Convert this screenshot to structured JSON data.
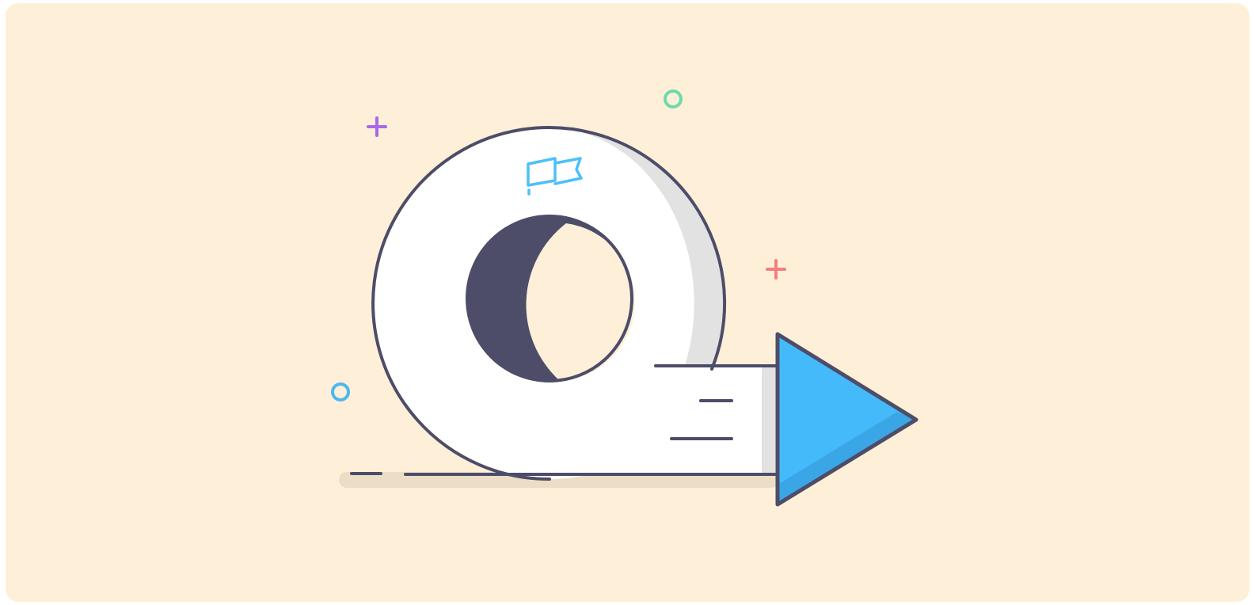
{
  "illustration": {
    "description_icons": [
      "roadmap-loop-icon",
      "flag-icon",
      "play-arrow-icon",
      "plus-icon",
      "circle-icon"
    ],
    "colors": {
      "background": "#FEF0D8",
      "outline": "#4D4D69",
      "ring_fill": "#FFFFFF",
      "ring_shade": "#E2E2E2",
      "arrow": "#45BAFB",
      "arrow_shade": "#3BA6E6",
      "flag": "#4DC0F8",
      "floor_shadow": "#ECDDC6",
      "sparkle_purple": "#A868E8",
      "sparkle_green": "#6FD9A8",
      "sparkle_red": "#F57F7F",
      "sparkle_blue": "#4DB8F0"
    }
  }
}
